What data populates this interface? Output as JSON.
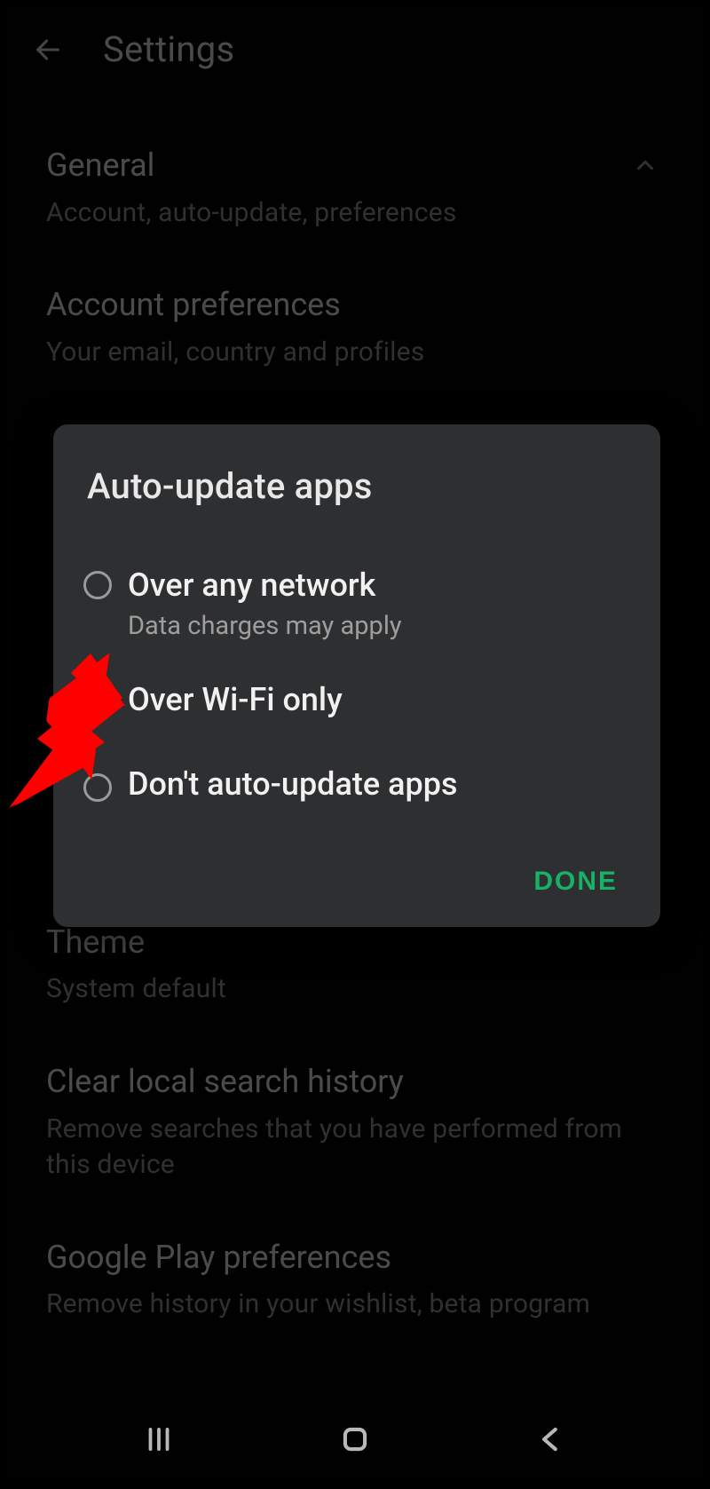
{
  "header": {
    "title": "Settings"
  },
  "sections": {
    "general": {
      "title": "General",
      "subtitle": "Account, auto-update, preferences"
    },
    "account_prefs": {
      "title": "Account preferences",
      "subtitle": "Your email, country and profiles"
    },
    "theme": {
      "title": "Theme",
      "subtitle": "System default"
    },
    "clear_history": {
      "title": "Clear local search history",
      "subtitle": "Remove searches that you have performed from this device"
    },
    "gplay_prefs": {
      "title": "Google Play preferences",
      "subtitle": "Remove history in your wishlist, beta program"
    }
  },
  "dialog": {
    "title": "Auto-update apps",
    "options": [
      {
        "label": "Over any network",
        "sub": "Data charges may apply",
        "selected": false
      },
      {
        "label": "Over Wi-Fi only",
        "sub": "",
        "selected": true
      },
      {
        "label": "Don't auto-update apps",
        "sub": "",
        "selected": false
      }
    ],
    "done": "DONE"
  },
  "colors": {
    "accent": "#17b268",
    "annotation": "#ff0000"
  }
}
